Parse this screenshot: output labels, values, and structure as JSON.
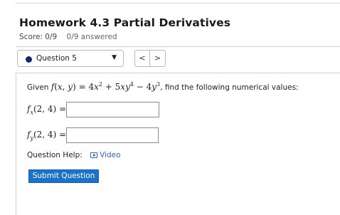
{
  "header": {
    "title": "Homework 4.3 Partial Derivatives",
    "score": "Score: 0/9",
    "answered": "0/9 answered"
  },
  "question_nav": {
    "selected": "Question 5",
    "prev_label": "<",
    "next_label": ">"
  },
  "question": {
    "prompt_start": "Given ",
    "prompt_end": ", find the following numerical values:",
    "function_latex": "f(x, y) = 4x^2 + 5xy^4 - 4y^3",
    "parts": [
      {
        "label_latex": "f_x(2, 4) =",
        "value": ""
      },
      {
        "label_latex": "f_y(2, 4) =",
        "value": ""
      }
    ],
    "help_label": "Question Help:",
    "video_label": "Video"
  },
  "actions": {
    "submit_label": "Submit Question"
  }
}
